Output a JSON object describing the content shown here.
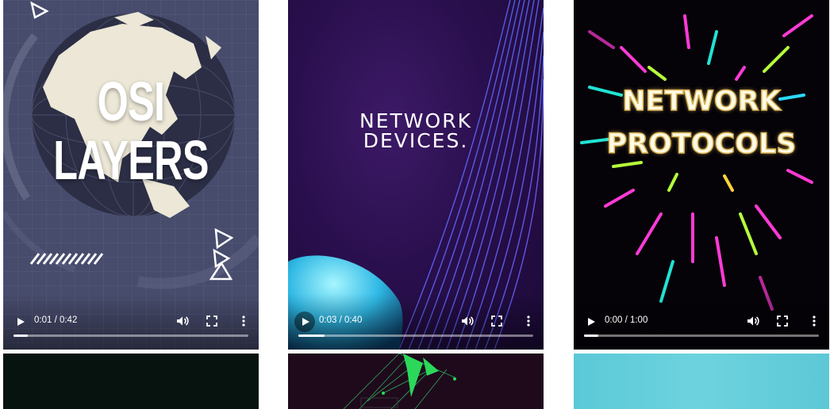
{
  "videos": [
    {
      "title_line1": "OSI",
      "title_line2": "LAYERS",
      "time": "0:01 / 0:42",
      "progress": 0.06,
      "accent": "#474b6c"
    },
    {
      "title_line1": "NETWORK",
      "title_line2": "DEVICES.",
      "time": "0:03 / 0:40",
      "progress": 0.11,
      "accent": "#2a0f4e"
    },
    {
      "title_line1": "NETWORK",
      "title_line2": "PROTOCOLS",
      "time": "0:00 / 1:00",
      "progress": 0.06,
      "accent": "#050208"
    }
  ],
  "controls": {
    "play_icon": "play-icon",
    "volume_icon": "volume-icon",
    "fullscreen_icon": "fullscreen-icon",
    "more_icon": "more-options-icon"
  },
  "thumbnails": [
    {
      "color": "#07130f"
    },
    {
      "color": "#1f0a1c"
    },
    {
      "color": "#5cc9d8"
    }
  ]
}
